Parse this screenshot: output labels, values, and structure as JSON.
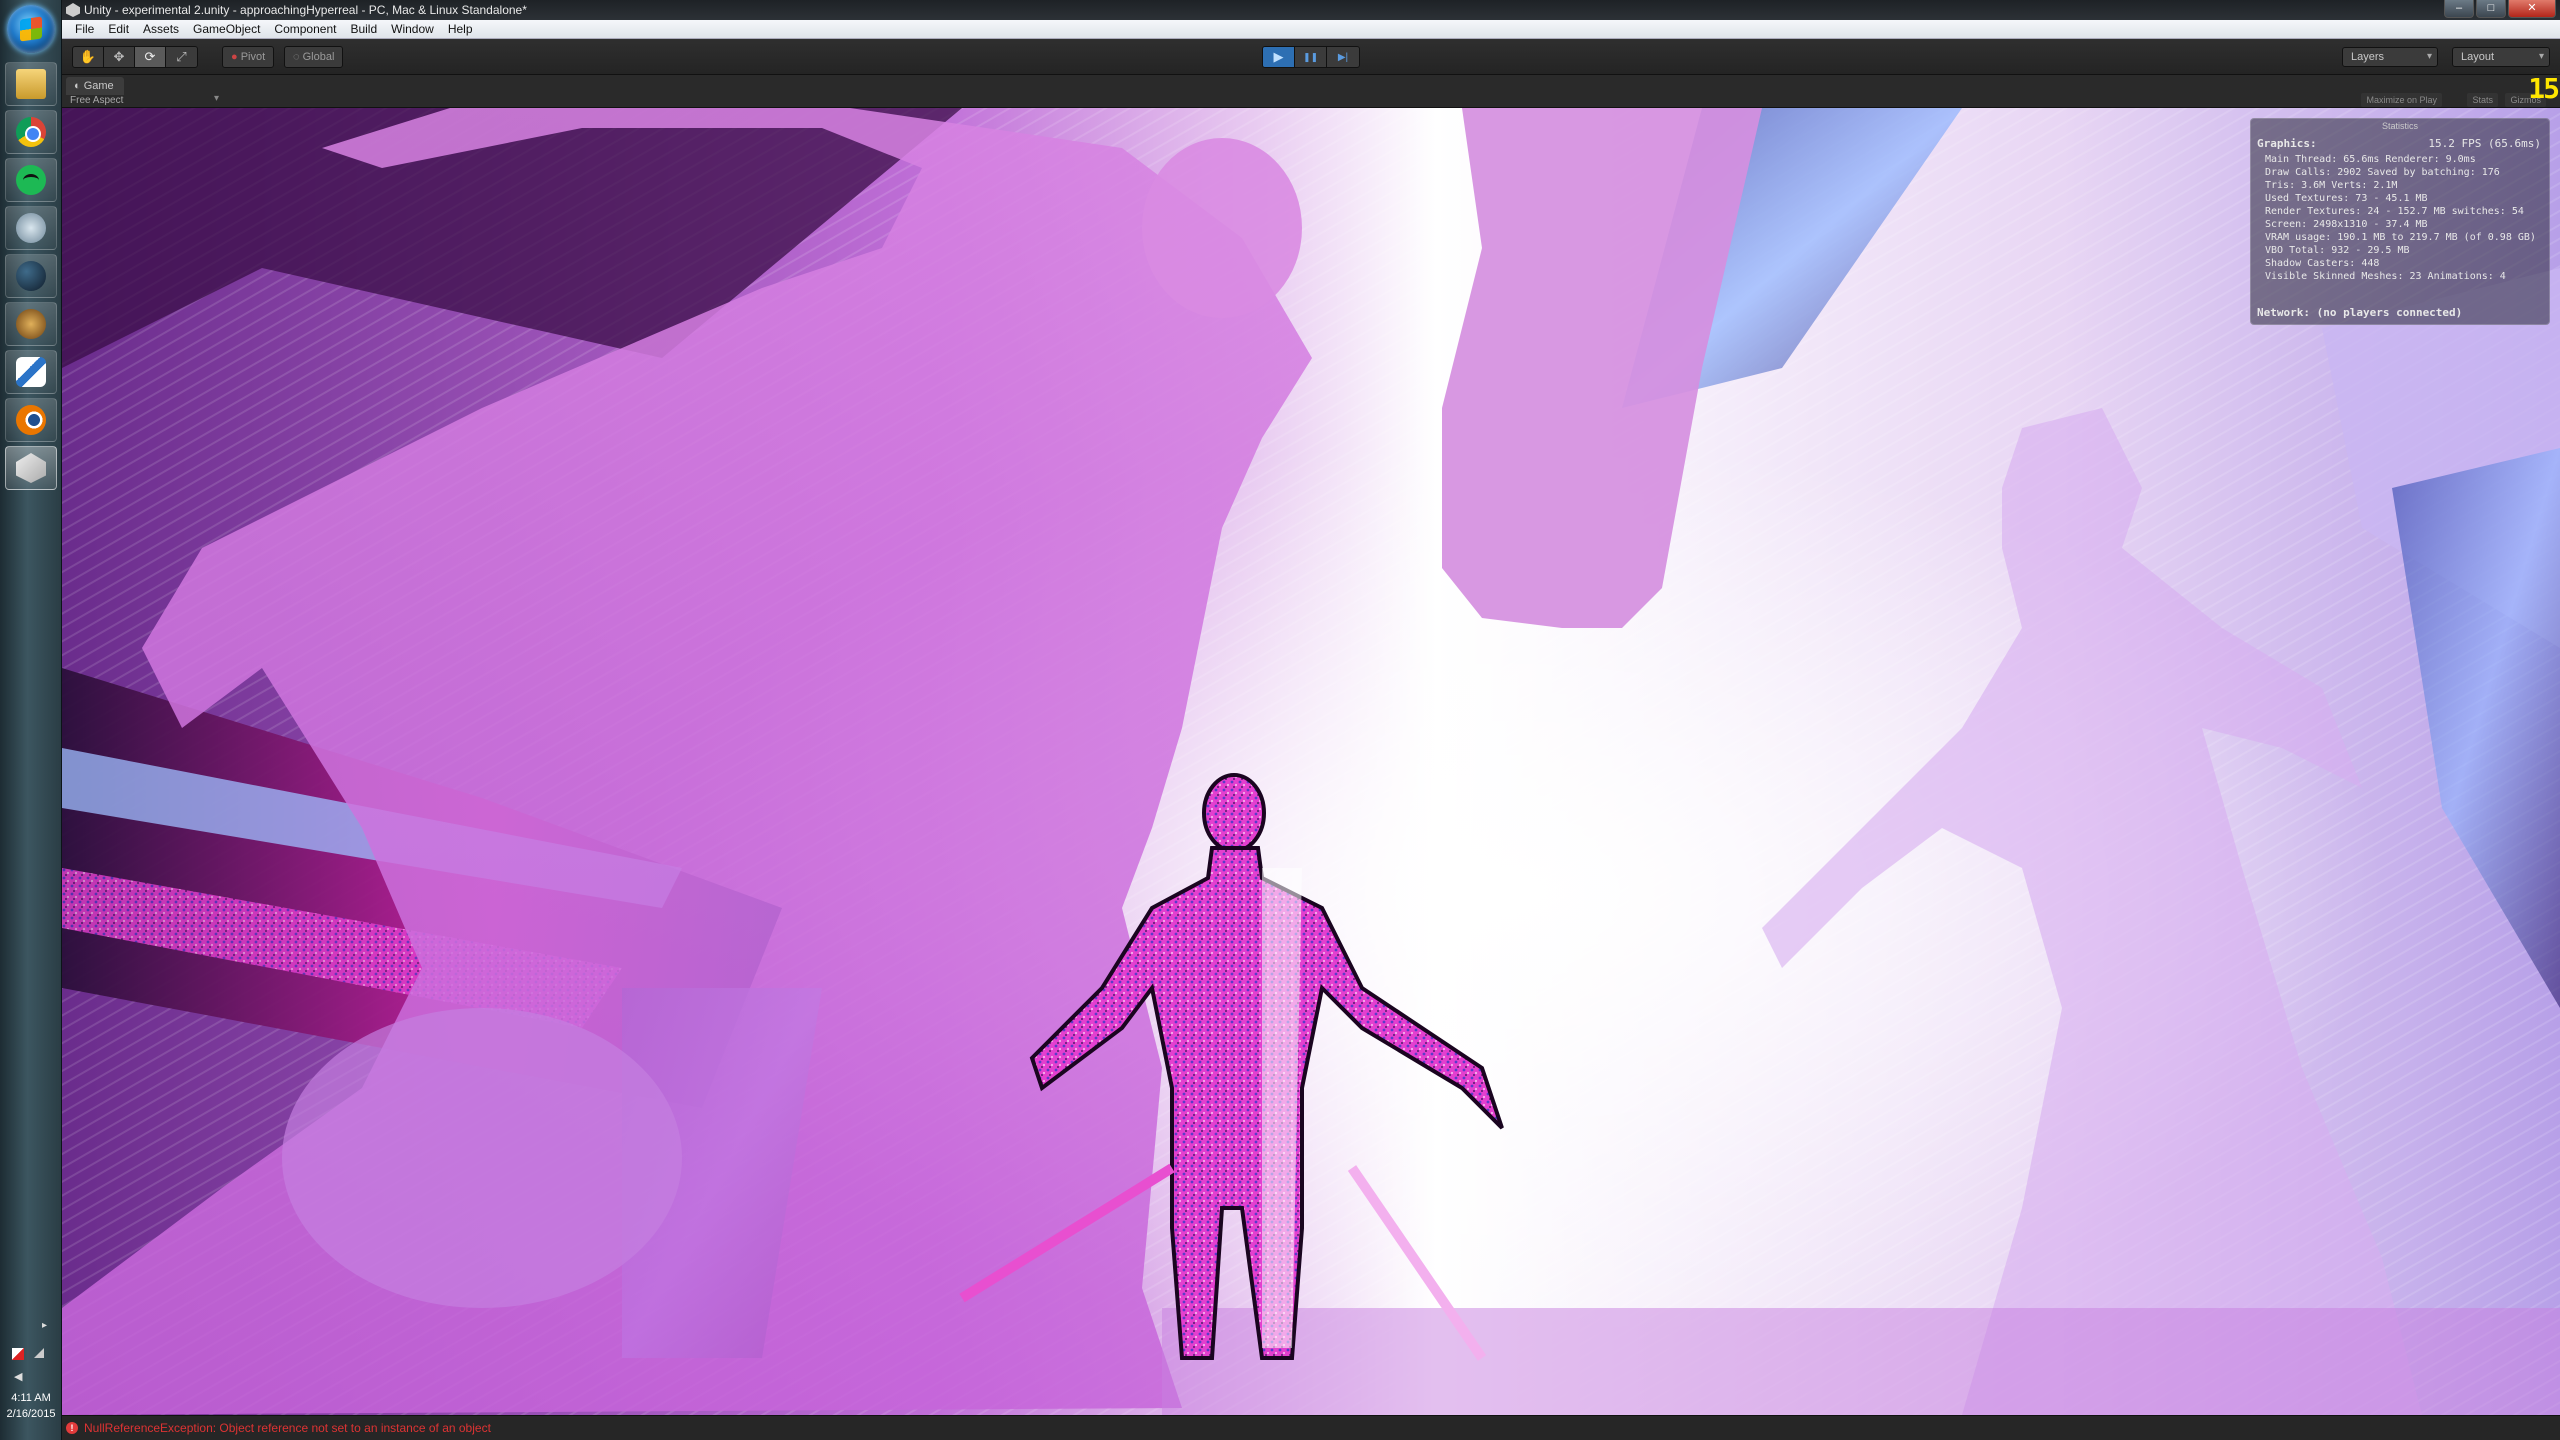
{
  "taskbar": {
    "apps": [
      {
        "name": "Windows Explorer",
        "icon": "folder-icon"
      },
      {
        "name": "Google Chrome",
        "icon": "chrome-icon"
      },
      {
        "name": "Spotify",
        "icon": "spotify-icon"
      },
      {
        "name": "Remote Desktop",
        "icon": "remote-desktop-icon"
      },
      {
        "name": "Steam",
        "icon": "steam-icon"
      },
      {
        "name": "World of Warcraft",
        "icon": "wow-icon"
      },
      {
        "name": "Paint",
        "icon": "paint-icon"
      },
      {
        "name": "Blender",
        "icon": "blender-icon"
      },
      {
        "name": "Unity",
        "icon": "unity-icon",
        "active": true
      }
    ],
    "clock": {
      "time": "4:11 AM",
      "date": "2/16/2015"
    }
  },
  "window": {
    "title": "Unity - experimental 2.unity - approachingHyperreal - PC, Mac & Linux Standalone*",
    "controls": {
      "minimize": "–",
      "maximize": "□",
      "close": "✕"
    }
  },
  "menu": [
    "File",
    "Edit",
    "Assets",
    "GameObject",
    "Component",
    "Build",
    "Window",
    "Help"
  ],
  "toolbar": {
    "transform_tools": [
      "hand-icon",
      "move-icon",
      "rotate-icon",
      "scale-icon"
    ],
    "pivot_label": "Pivot",
    "global_label": "Global",
    "play_controls": {
      "play": "▶",
      "pause": "❚❚",
      "step": "▶|"
    },
    "layers_label": "Layers",
    "layout_label": "Layout"
  },
  "game_view": {
    "tab_label": "Game",
    "aspect_label": "Free Aspect",
    "options": {
      "maximize": "Maximize on Play",
      "stats": "Stats",
      "gizmos": "Gizmos"
    },
    "fps_overlay": "15"
  },
  "stats": {
    "title": "Statistics",
    "graphics_label": "Graphics:",
    "fps": "15.2 FPS (65.6ms)",
    "lines": [
      "Main Thread: 65.6ms  Renderer: 9.0ms",
      "Draw Calls: 2902  Saved by batching: 176",
      "Tris: 3.6M   Verts: 2.1M",
      "Used Textures: 73 - 45.1 MB",
      "Render Textures: 24 - 152.7 MB   switches: 54",
      "Screen: 2498x1310 - 37.4 MB",
      "VRAM usage: 190.1 MB to 219.7 MB (of 0.98 GB)",
      "VBO Total: 932 - 29.5 MB",
      "Shadow Casters: 448",
      "Visible Skinned Meshes: 23   Animations: 4"
    ],
    "network": "Network: (no players connected)"
  },
  "status": {
    "message": "NullReferenceException: Object reference not set to an instance of an object"
  },
  "colors": {
    "accent_play": "#2d6fb3",
    "error_red": "#dd3333",
    "fps_yellow": "#ffe600",
    "magenta": "#e040d0"
  }
}
